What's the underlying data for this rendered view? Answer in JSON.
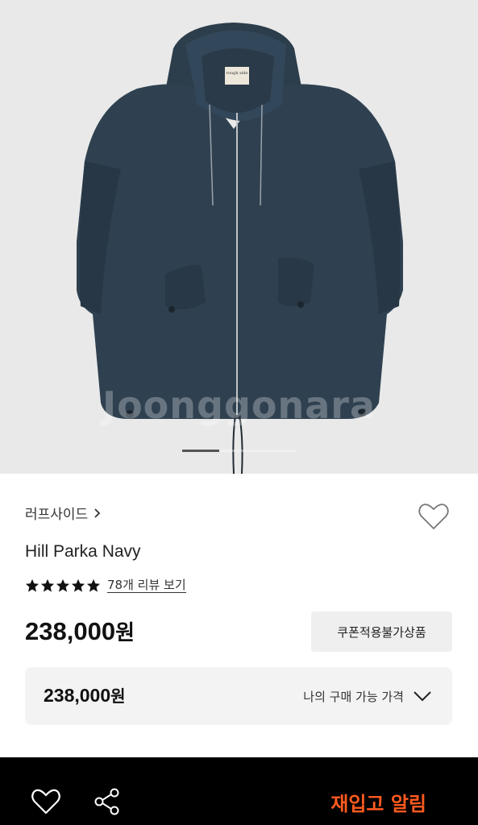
{
  "product_image": {
    "watermark": "Joonggonara",
    "label_tag": "rough side",
    "slides_total": 3,
    "active_slide": 1
  },
  "brand": {
    "name": "러프사이드"
  },
  "product": {
    "title": "Hill Parka Navy",
    "rating_stars": 5,
    "review_text": "78개 리뷰 보기",
    "price_number": "238,000",
    "price_unit": "원",
    "coupon_badge": "쿠폰적용불가상품"
  },
  "my_price": {
    "price_number": "238,000",
    "price_unit": "원",
    "label": "나의 구매 가능 가격"
  },
  "bottom_bar": {
    "restock_label": "재입고 알림"
  },
  "colors": {
    "accent": "#ff5a1f",
    "jacket": "#2f4150",
    "background_image": "#e9e9e9",
    "bottom_bar": "#000000"
  },
  "icons": {
    "brand_chevron": "chevron-right-icon",
    "wishlist": "heart-outline-icon",
    "star": "star-filled-icon",
    "expand": "chevron-down-icon",
    "share": "share-icon"
  }
}
